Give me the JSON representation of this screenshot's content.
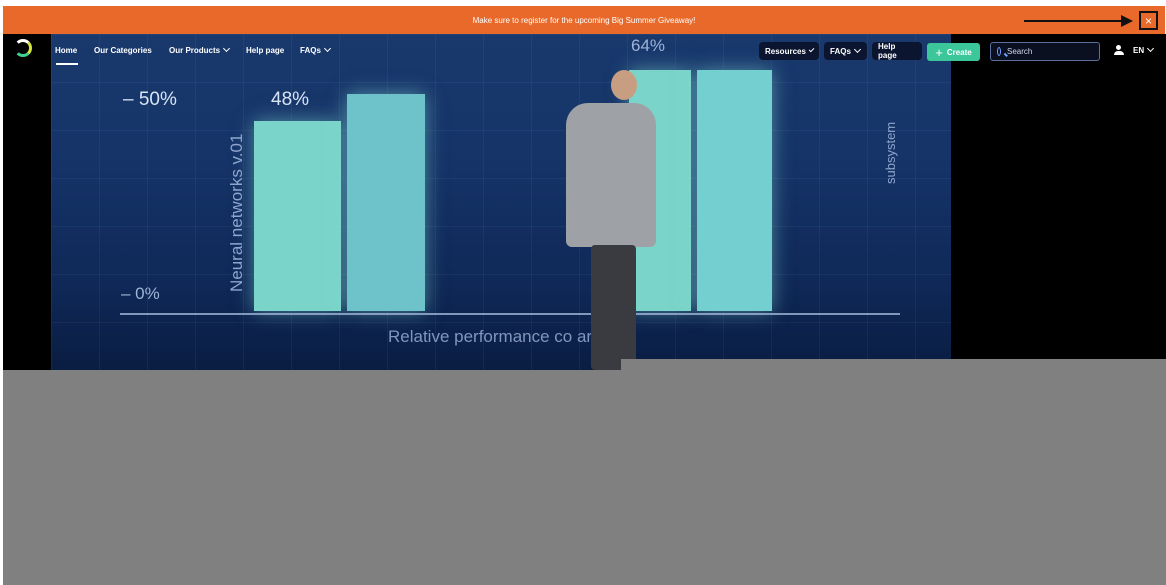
{
  "banner": {
    "message": "Make sure to register for the upcoming Big Summer Giveaway!",
    "close_label": "×",
    "color": "#e8692a"
  },
  "nav": {
    "logo_icon": "ring-logo-icon",
    "left_items": [
      {
        "label": "Home",
        "active": true
      },
      {
        "label": "Our Categories"
      },
      {
        "label": "Our Products",
        "has_dropdown": true
      },
      {
        "label": "Help page"
      },
      {
        "label": "FAQs",
        "has_dropdown": true
      }
    ],
    "right_items": [
      {
        "label": "Resources",
        "has_dropdown": true
      },
      {
        "label": "FAQs",
        "has_dropdown": true
      },
      {
        "label": "Help page"
      }
    ],
    "create_label": "Create",
    "create_color": "#3cc79a",
    "search_placeholder": "Search",
    "language": "EN"
  },
  "hero": {
    "screen_labels": {
      "pct_50": "– 50%",
      "pct_48": "48%",
      "pct_64": "64%",
      "pct_0": "– 0%",
      "vertical_left": "Neural networks v.01",
      "vertical_right": "subsystem",
      "caption": "Relative performance co      aris"
    }
  }
}
